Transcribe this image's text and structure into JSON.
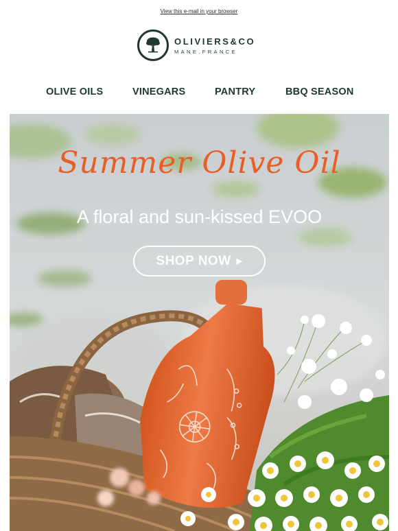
{
  "preheader": {
    "link_text": "View this e-mail in your browser"
  },
  "logo": {
    "brand": "OLIVIERS&CO",
    "place": "MANE.FRANCE",
    "icon": "olive-tree-icon"
  },
  "nav": {
    "items": [
      {
        "label": "OLIVE OILS"
      },
      {
        "label": "VINEGARS"
      },
      {
        "label": "PANTRY"
      },
      {
        "label": "BBQ SEASON"
      }
    ]
  },
  "hero": {
    "title": "Summer Olive Oil",
    "subtitle": "A floral and sun-kissed EVOO",
    "cta_label": "SHOP NOW",
    "cta_icon": "play-arrow-icon"
  },
  "colors": {
    "brand_green": "#1f3a2c",
    "accent_orange": "#e85e26",
    "bottle_orange": "#e8743d"
  }
}
